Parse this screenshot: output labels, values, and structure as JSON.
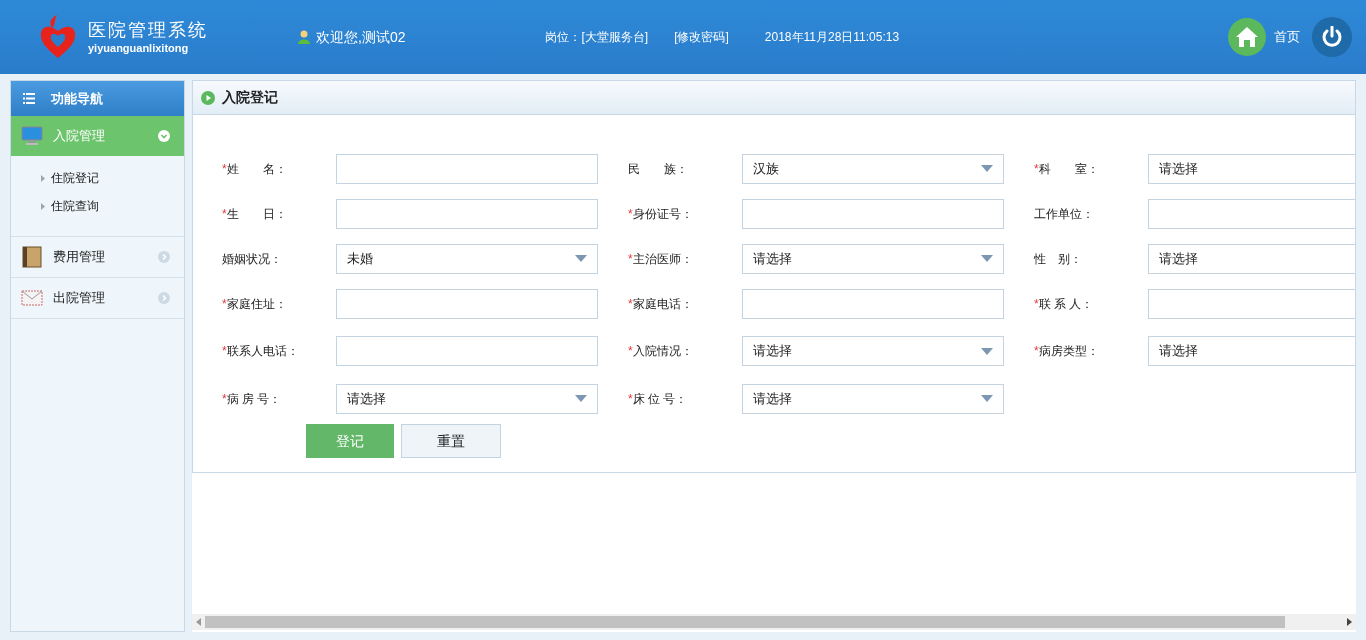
{
  "header": {
    "logo_title": "医院管理系统",
    "logo_subtitle": "yiyuanguanlixitong",
    "welcome": "欢迎您,测试02",
    "post": "岗位：[大堂服务台]",
    "change_password": "[修改密码]",
    "datetime": "2018年11月28日11:05:13",
    "home": "首页"
  },
  "sidebar": {
    "title": "功能导航",
    "groups": [
      {
        "label": "入院管理",
        "kind": "monitor",
        "expanded": true,
        "children": [
          {
            "label": "住院登记"
          },
          {
            "label": "住院查询"
          }
        ]
      },
      {
        "label": "费用管理",
        "kind": "book",
        "expanded": false
      },
      {
        "label": "出院管理",
        "kind": "envelope",
        "expanded": false
      }
    ]
  },
  "panel": {
    "title": "入院登记",
    "rows": [
      [
        {
          "mark": "*",
          "label": "姓　　名：",
          "kind": "text"
        },
        {
          "label": "民　　族：",
          "kind": "select",
          "value": "汉族"
        },
        {
          "mark": "*",
          "label": "科　　室：",
          "kind": "combo",
          "value": "请选择"
        }
      ],
      [
        {
          "mark": "*",
          "label": "生　　日：",
          "kind": "text"
        },
        {
          "mark": "*",
          "label": "身份证号：",
          "kind": "text"
        },
        {
          "label": "工作单位：",
          "kind": "text"
        }
      ],
      [
        {
          "label": "婚姻状况：",
          "kind": "select",
          "value": "未婚"
        },
        {
          "mark": "*",
          "label": "主治医师：",
          "kind": "select",
          "value": "请选择"
        },
        {
          "label": "性　别：",
          "kind": "combo",
          "value": "请选择"
        }
      ],
      [
        {
          "mark": "*",
          "label": "家庭住址：",
          "kind": "text"
        },
        {
          "mark": "*",
          "label": "家庭电话：",
          "kind": "text"
        },
        {
          "mark": "*",
          "label": "联 系 人：",
          "kind": "text"
        }
      ],
      [
        {
          "mark": "*",
          "label": "联系人电话：",
          "kind": "text"
        },
        {
          "mark": "*",
          "label": "入院情况：",
          "kind": "select",
          "value": "请选择"
        },
        {
          "mark": "*",
          "label": "病房类型：",
          "kind": "combo",
          "value": "请选择"
        }
      ],
      [
        {
          "mark": "*",
          "label": "病 房 号：",
          "kind": "select",
          "value": "请选择"
        },
        {
          "mark": "*",
          "label": "床 位 号：",
          "kind": "select",
          "value": "请选择"
        }
      ]
    ],
    "buttons": [
      {
        "label": "登记",
        "kind": "primary"
      },
      {
        "label": "重置",
        "kind": "secondary"
      }
    ]
  }
}
